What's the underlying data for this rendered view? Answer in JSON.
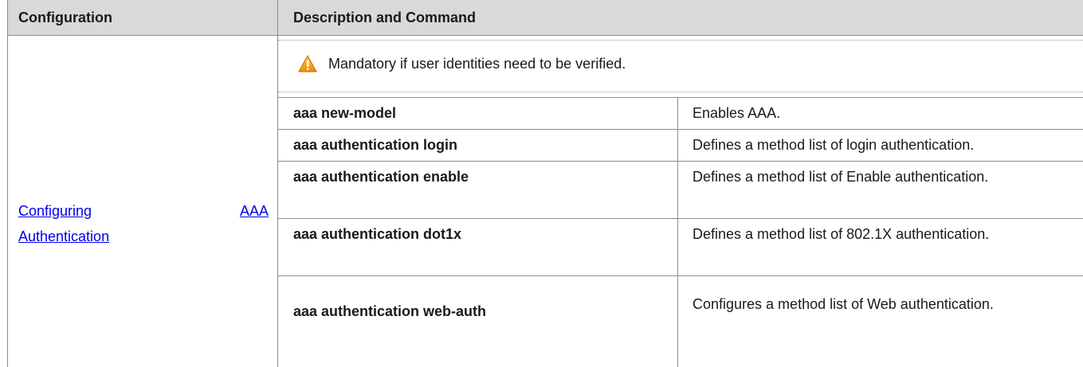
{
  "header": {
    "col1": "Configuration",
    "col2": "Description and Command"
  },
  "configuration": {
    "link_line1_word1": "Configuring",
    "link_line1_word2": "AAA",
    "link_line2": "Authentication"
  },
  "note": {
    "icon": "warning-icon",
    "text": "Mandatory if user identities need to be verified."
  },
  "rows": [
    {
      "command": "aaa new-model",
      "description": "Enables AAA."
    },
    {
      "command": "aaa authentication login",
      "description": "Defines a method list of login authentication."
    },
    {
      "command": "aaa authentication enable",
      "description": "Defines a method list of Enable authentication."
    },
    {
      "command": "aaa authentication dot1x",
      "description": "Defines a method list of 802.1X authentication."
    },
    {
      "command": "aaa authentication web-auth",
      "description": "Configures a method list of Web authentication."
    }
  ],
  "colors": {
    "header_bg": "#d9d9d9",
    "link": "#0000ee",
    "warning": "#f5a623"
  }
}
